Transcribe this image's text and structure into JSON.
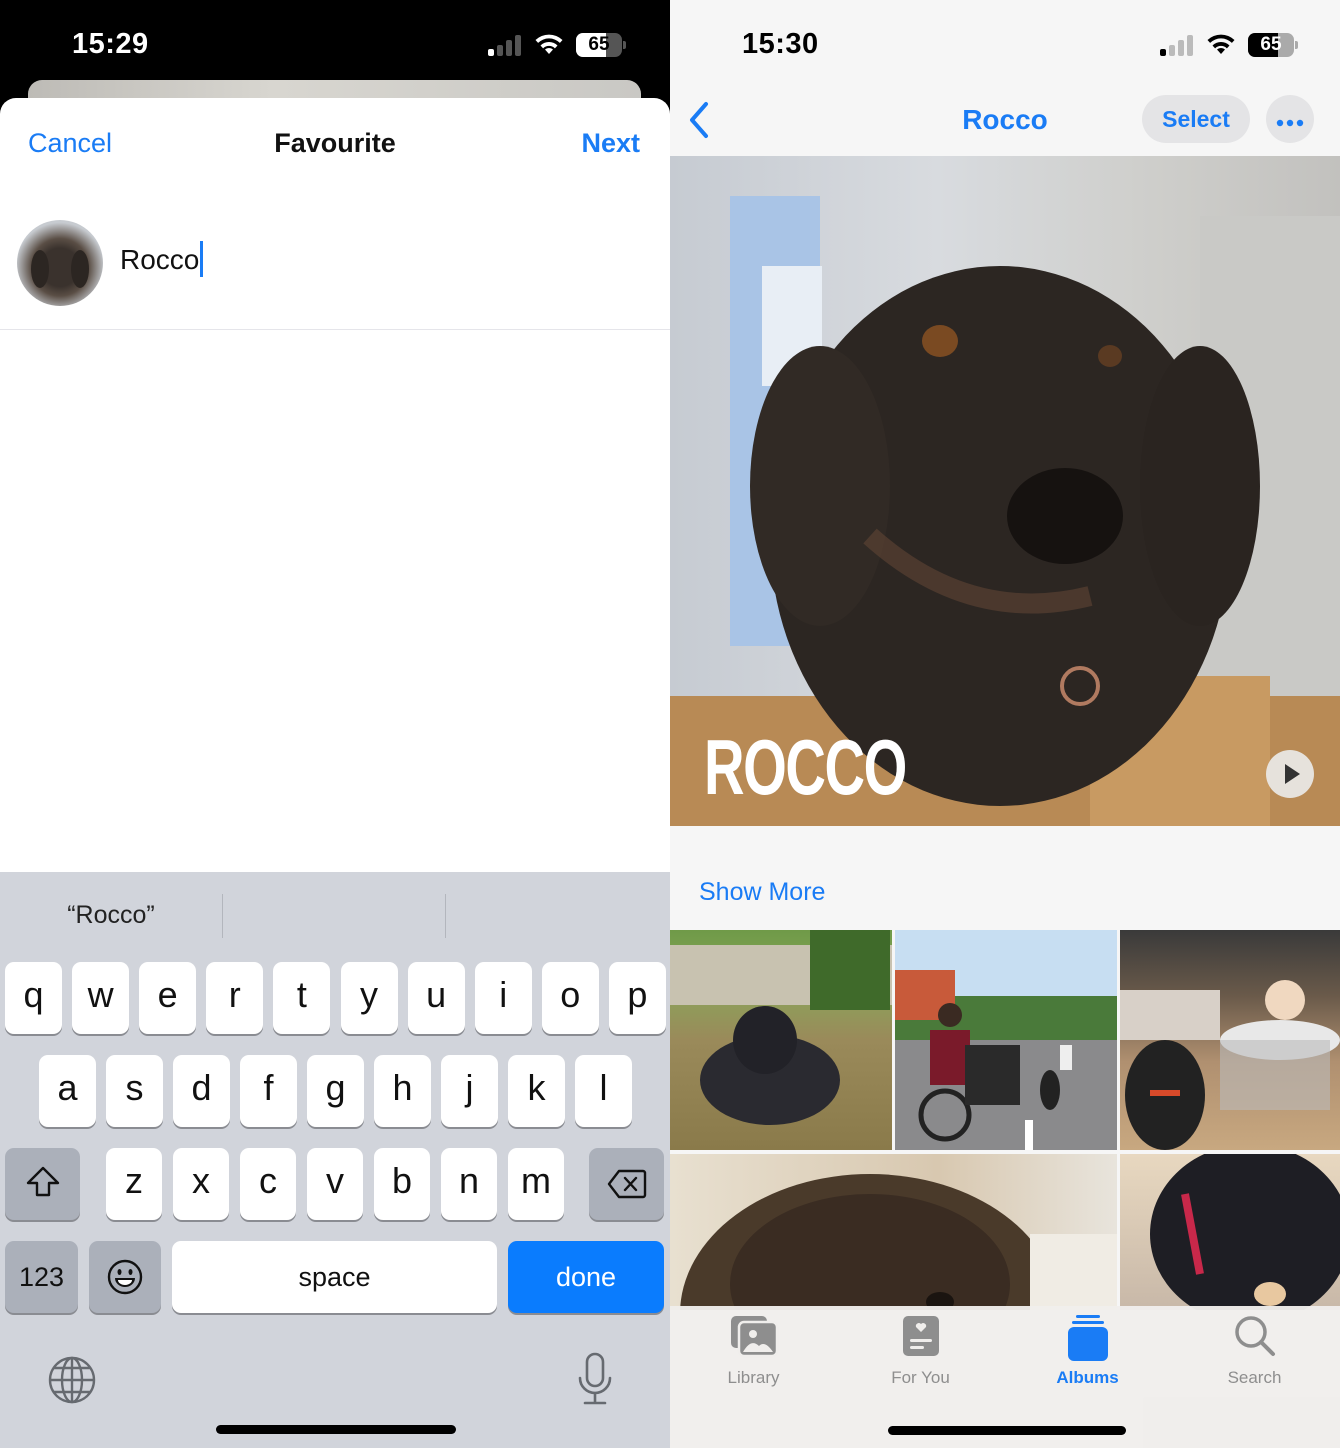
{
  "left_screen": {
    "status_bar": {
      "time": "15:29",
      "battery": "65",
      "icons": [
        "cellular-signal-icon",
        "wifi-icon",
        "battery-icon"
      ]
    },
    "nav": {
      "cancel_label": "Cancel",
      "title": "Favourite",
      "next_label": "Next"
    },
    "name_field": {
      "value": "Rocco",
      "avatar": "dog-avatar"
    },
    "keyboard": {
      "suggestions": [
        "“Rocco”",
        "",
        ""
      ],
      "row1": [
        "q",
        "w",
        "e",
        "r",
        "t",
        "y",
        "u",
        "i",
        "o",
        "p"
      ],
      "row2": [
        "a",
        "s",
        "d",
        "f",
        "g",
        "h",
        "j",
        "k",
        "l"
      ],
      "row3": [
        "z",
        "x",
        "c",
        "v",
        "b",
        "n",
        "m"
      ],
      "numbers_label": "123",
      "space_label": "space",
      "done_label": "done"
    },
    "colors": {
      "accent": "#1a7cf5",
      "keyboard_bg": "#d1d4db",
      "done_key": "#0a7cfe"
    }
  },
  "right_screen": {
    "status_bar": {
      "time": "15:30",
      "battery": "65"
    },
    "nav": {
      "title": "Rocco",
      "select_label": "Select",
      "more_icon": "ellipsis-icon"
    },
    "hero": {
      "title": "ROCCO",
      "play_icon": "play-icon"
    },
    "show_more_label": "Show More",
    "photos": [
      {
        "description": "Dog lying on grass in garden"
      },
      {
        "description": "Man on cargo bike with child and dog on road"
      },
      {
        "description": "Dog sitting next to baby in walker"
      },
      {
        "description": "Close-up of dog's fur"
      },
      {
        "description": "Dog with red collar eating"
      }
    ],
    "tabs": [
      {
        "label": "Library",
        "icon": "photo-library-icon",
        "active": false
      },
      {
        "label": "For You",
        "icon": "for-you-icon",
        "active": false
      },
      {
        "label": "Albums",
        "icon": "albums-icon",
        "active": true
      },
      {
        "label": "Search",
        "icon": "search-icon",
        "active": false
      }
    ]
  }
}
